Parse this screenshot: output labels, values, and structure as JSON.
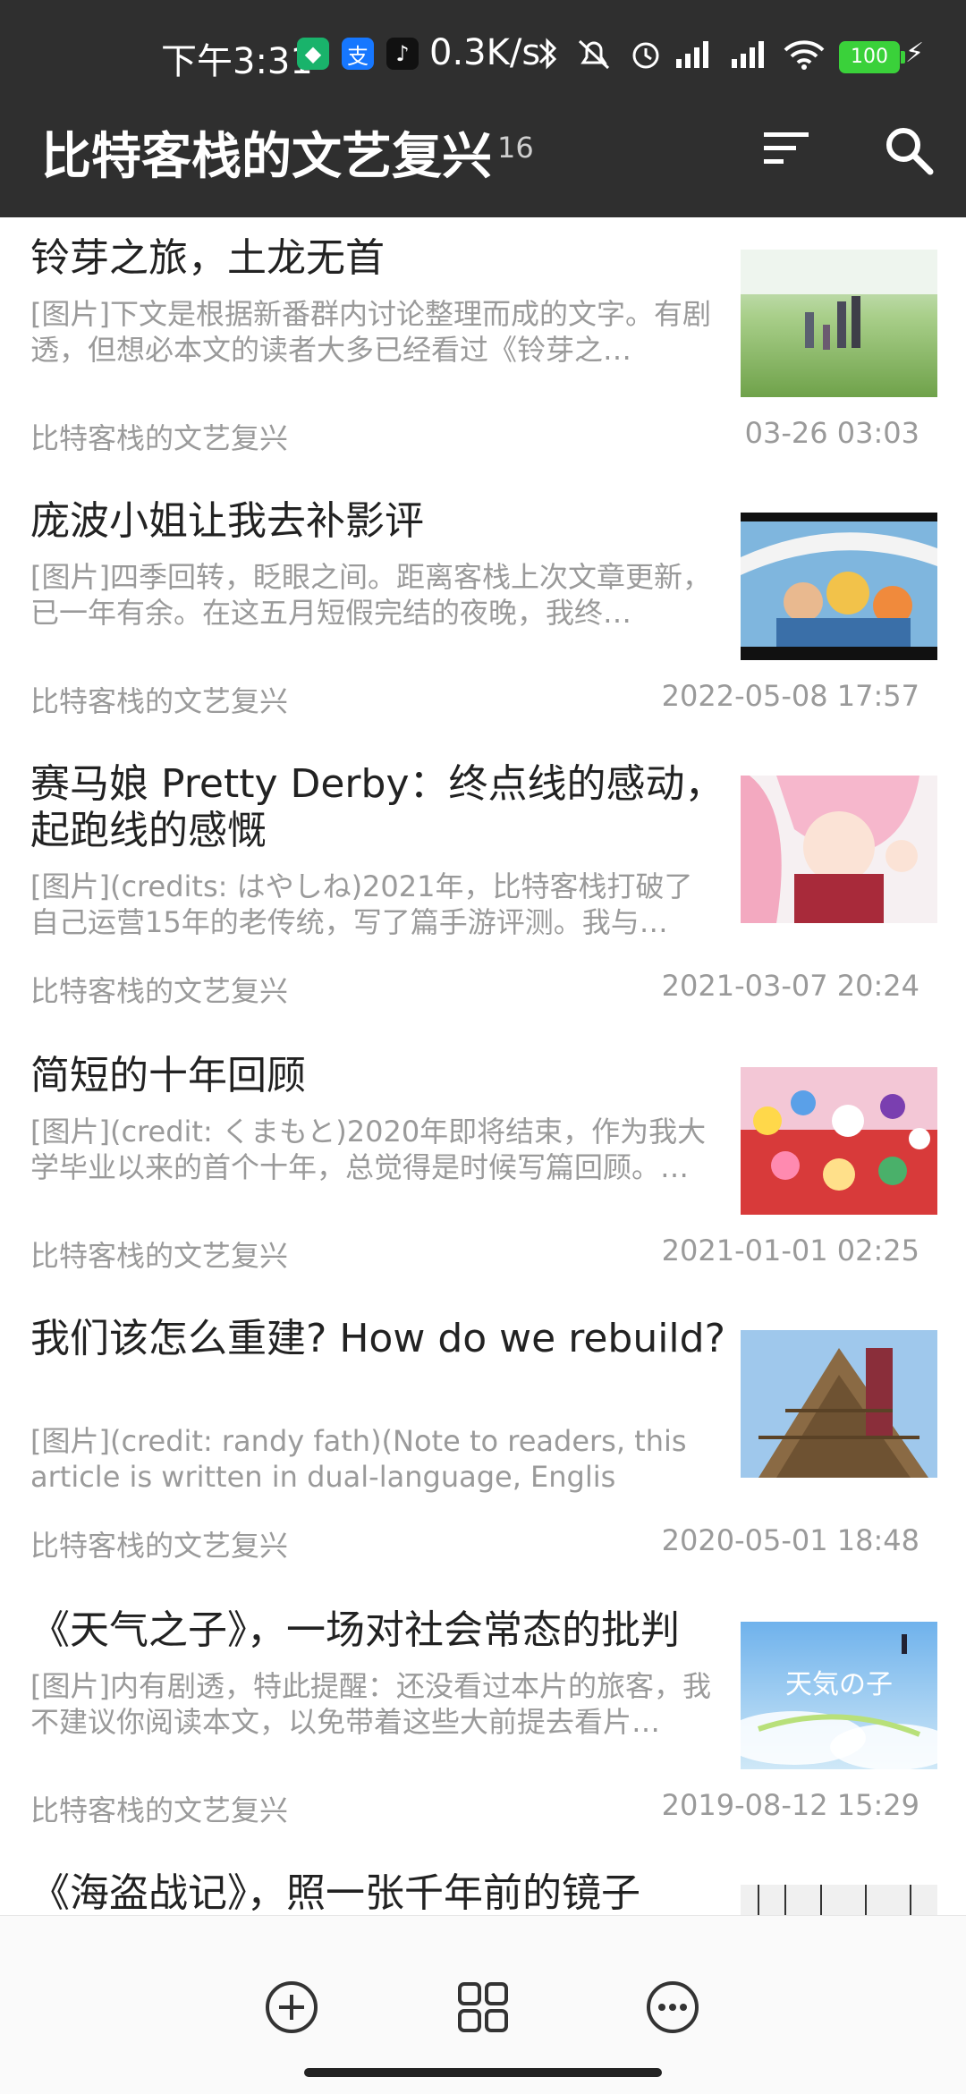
{
  "status_bar": {
    "time": "下午3:31",
    "speed": "0.3K/s",
    "battery": "100",
    "app_icons": [
      "shield-icon",
      "alipay-icon",
      "tiktok-icon"
    ],
    "alipay_glyph": "支",
    "tiktok_glyph": "♪",
    "shield_glyph": "◆"
  },
  "app_bar": {
    "title": "比特客栈的文艺复兴",
    "count": "16"
  },
  "articles": [
    {
      "title": "铃芽之旅，土龙无首",
      "summary": "[图片]下文是根据新番群内讨论整理而成的文字。有剧透，但想必本文的读者大多已经看过《铃芽之…",
      "source": "比特客栈的文艺复兴",
      "date": "03-26 03:03"
    },
    {
      "title": "庞波小姐让我去补影评",
      "summary": "[图片]四季回转，眨眼之间。距离客栈上次文章更新，已一年有余。在这五月短假完结的夜晚，我终…",
      "source": "比特客栈的文艺复兴",
      "date": "2022-05-08 17:57"
    },
    {
      "title": "赛马娘 Pretty Derby：终点线的感动，起跑线的感慨",
      "summary": "[图片](credits: はやしね)2021年，比特客栈打破了自己运营15年的老传统，写了篇手游评测。我与Prett…",
      "source": "比特客栈的文艺复兴",
      "date": "2021-03-07 20:24"
    },
    {
      "title": "简短的十年回顾",
      "summary": "[图片](credit: くまもと)2020年即将结束，作为我大学毕业以来的首个十年，总觉得是时候写篇回顾。…",
      "source": "比特客栈的文艺复兴",
      "date": "2021-01-01 02:25"
    },
    {
      "title": "我们该怎么重建? How do we rebuild?",
      "summary": "[图片](credit: randy fath)(Note to readers, this article is written in dual-language, Englis",
      "source": "比特客栈的文艺复兴",
      "date": "2020-05-01 18:48"
    },
    {
      "title": "《天气之子》，一场对社会常态的批判",
      "summary": "[图片]内有剧透，特此提醒：还没看过本片的旅客，我不建议你阅读本文，以免带着这些大前提去看片…",
      "source": "比特客栈的文艺复兴",
      "date": "2019-08-12 15:29"
    },
    {
      "title": "《海盗战记》，照一张千年前的镜子",
      "summary": "",
      "source": "",
      "date": ""
    }
  ],
  "thumb_text": {
    "weathering": "天気の子"
  },
  "colors": {
    "app_bar": "#2f2f2f",
    "secondary_text": "#9a9a9a",
    "battery": "#3ad13a"
  },
  "bottom_bar": {
    "icons": [
      "add-circle-icon",
      "grid-icon",
      "more-icon"
    ]
  }
}
